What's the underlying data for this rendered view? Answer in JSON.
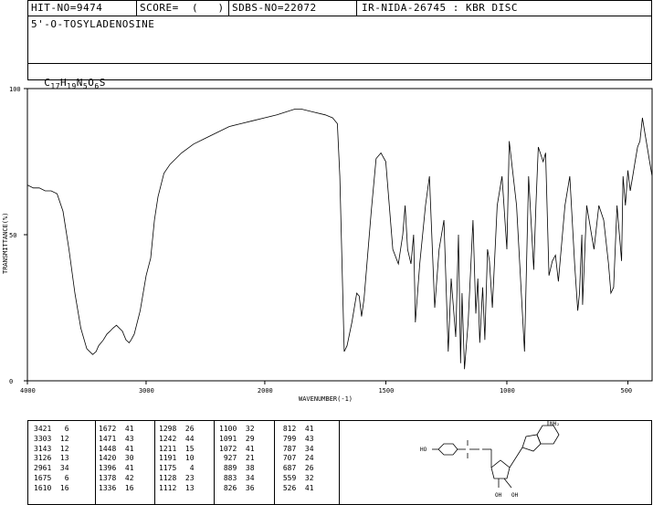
{
  "header": {
    "hit_no": "HIT-NO=9474",
    "score": "SCORE=  (   )",
    "sdbs_no": "SDBS-NO=22072",
    "method": "IR-NIDA-26745 : KBR DISC"
  },
  "compound": {
    "name": "5'-O-TOSYLADENOSINE",
    "formula_prefix": "C",
    "formula_c": "17",
    "formula_h_prefix": "H",
    "formula_h": "19",
    "formula_n_prefix": "N",
    "formula_n": "5",
    "formula_o_prefix": "O",
    "formula_o": "6",
    "formula_s": "S"
  },
  "structure_labels": {
    "nh2": "NH₂",
    "ho": "HO",
    "oh1": "OH",
    "oh2": "OH"
  },
  "chart_data": {
    "type": "line",
    "xlabel": "WAVENUMBER(-1)",
    "ylabel": "TRANSMITTANCE(%)",
    "xlim": [
      4000,
      400
    ],
    "ylim": [
      0,
      100
    ],
    "x_ticks": [
      "4000",
      "3000",
      "2000",
      "1500",
      "1000",
      "500"
    ],
    "y_ticks": [
      "100",
      "50",
      "0"
    ],
    "series": [
      {
        "x": [
          4000,
          3950,
          3900,
          3850,
          3800,
          3750,
          3700,
          3650,
          3600,
          3550,
          3500,
          3450,
          3421,
          3400,
          3360,
          3330,
          3303,
          3280,
          3250,
          3200,
          3170,
          3143,
          3126,
          3100,
          3050,
          3000,
          2961,
          2930,
          2900,
          2850,
          2800,
          2700,
          2600,
          2500,
          2400,
          2300,
          2200,
          2100,
          2000,
          1950,
          1875,
          1850,
          1800,
          1750,
          1720,
          1700,
          1690,
          1672,
          1660,
          1640,
          1620,
          1610,
          1600,
          1590,
          1560,
          1540,
          1520,
          1500,
          1471,
          1448,
          1430,
          1420,
          1410,
          1396,
          1385,
          1378,
          1360,
          1336,
          1320,
          1298,
          1280,
          1260,
          1242,
          1230,
          1211,
          1200,
          1191,
          1185,
          1175,
          1160,
          1140,
          1128,
          1120,
          1112,
          1100,
          1091,
          1080,
          1072,
          1060,
          1040,
          1020,
          1000,
          990,
          960,
          927,
          910,
          889,
          880,
          870,
          850,
          840,
          826,
          812,
          799,
          787,
          760,
          740,
          720,
          707,
          700,
          690,
          687,
          670,
          650,
          640,
          620,
          600,
          580,
          570,
          559,
          545,
          526,
          520,
          510,
          500,
          490,
          480,
          470,
          460,
          450,
          440,
          430,
          420,
          410,
          400
        ],
        "y": [
          67,
          66,
          66,
          65,
          65,
          64,
          58,
          45,
          30,
          18,
          11,
          9,
          10,
          12,
          14,
          16,
          17,
          18,
          19,
          17,
          14,
          13,
          14,
          16,
          24,
          36,
          42,
          55,
          63,
          71,
          74,
          78,
          81,
          83,
          85,
          87,
          88,
          89,
          90,
          91,
          93,
          93,
          92,
          91,
          90,
          88,
          70,
          10,
          12,
          20,
          30,
          29,
          22,
          28,
          58,
          76,
          78,
          75,
          45,
          40,
          50,
          60,
          45,
          40,
          50,
          20,
          40,
          60,
          70,
          25,
          45,
          55,
          10,
          35,
          15,
          50,
          6,
          30,
          4,
          20,
          55,
          23,
          35,
          13,
          32,
          14,
          45,
          41,
          25,
          60,
          70,
          45,
          82,
          60,
          10,
          70,
          38,
          60,
          80,
          75,
          78,
          36,
          41,
          43,
          34,
          60,
          70,
          40,
          24,
          30,
          50,
          26,
          60,
          50,
          45,
          60,
          55,
          40,
          30,
          32,
          60,
          41,
          70,
          60,
          72,
          65,
          70,
          75,
          80,
          82,
          90,
          85,
          80,
          75,
          70
        ]
      }
    ]
  },
  "peak_table": {
    "col1": [
      "3421   6",
      "3303  12",
      "3143  12",
      "3126  13",
      "2961  34",
      "1675   6",
      "1610  16"
    ],
    "col2": [
      "1672  41",
      "1471  43",
      "1448  41",
      "1420  30",
      "1396  41",
      "1378  42",
      "1336  16"
    ],
    "col3": [
      "1298  26",
      "1242  44",
      "1211  15",
      "1191  10",
      "1175   4",
      "1128  23",
      "1112  13"
    ],
    "col4": [
      "1100  32",
      "1091  29",
      "1072  41",
      " 927  21",
      " 889  38",
      " 883  34",
      " 826  36"
    ],
    "col5": [
      " 812  41",
      " 799  43",
      " 787  34",
      " 707  24",
      " 687  26",
      " 559  32",
      " 526  41"
    ]
  }
}
